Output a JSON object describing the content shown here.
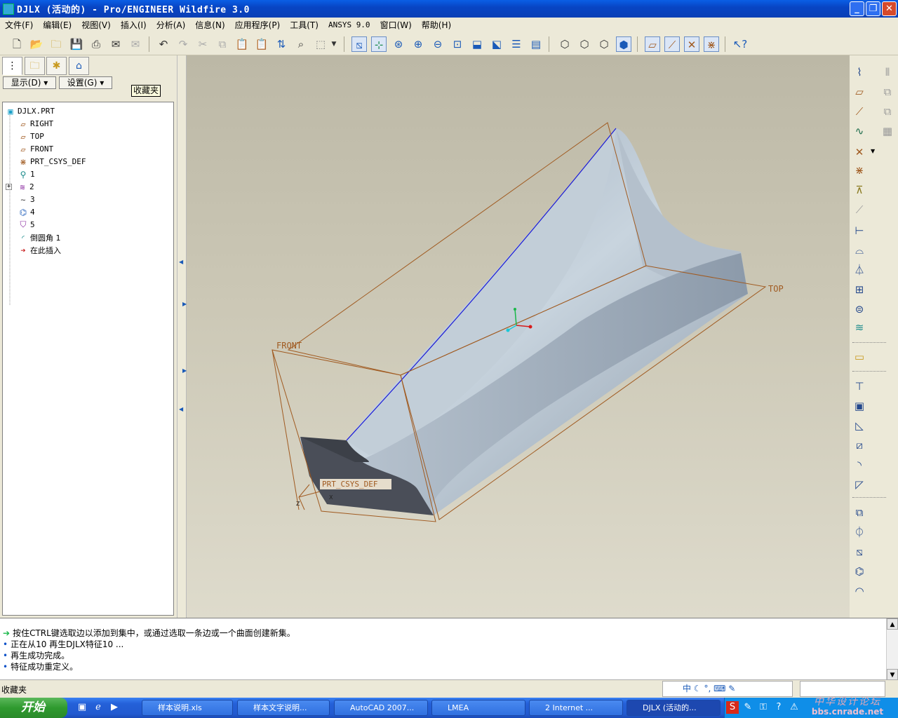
{
  "window": {
    "title": "DJLX (活动的) - Pro/ENGINEER Wildfire 3.0",
    "minimize": "_",
    "restore": "❐",
    "close": "✕"
  },
  "menu": [
    "文件(F)",
    "编辑(E)",
    "视图(V)",
    "插入(I)",
    "分析(A)",
    "信息(N)",
    "应用程序(P)",
    "工具(T)",
    "ANSYS 9.0",
    "窗口(W)",
    "帮助(H)"
  ],
  "left_panel": {
    "display_button": "显示(D)",
    "settings_button": "设置(G)",
    "tooltip": "收藏夹",
    "tree": [
      {
        "label": "DJLX.PRT",
        "icon": "part-icon"
      },
      {
        "label": "RIGHT",
        "icon": "datum-plane-icon"
      },
      {
        "label": "TOP",
        "icon": "datum-plane-icon"
      },
      {
        "label": "FRONT",
        "icon": "datum-plane-icon"
      },
      {
        "label": "PRT_CSYS_DEF",
        "icon": "csys-icon"
      },
      {
        "label": "1",
        "icon": "feature-icon"
      },
      {
        "label": "2",
        "icon": "sketch-group-icon"
      },
      {
        "label": "3",
        "icon": "curve-icon"
      },
      {
        "label": "4",
        "icon": "surface-icon"
      },
      {
        "label": "5",
        "icon": "boundary-icon"
      },
      {
        "label": "倒圆角 1",
        "icon": "round-icon"
      },
      {
        "label": "在此插入",
        "icon": "insert-arrow-icon"
      }
    ]
  },
  "viewport": {
    "labels": {
      "front": "FRONT",
      "top": "TOP",
      "csys": "PRT_CSYS_DEF",
      "x_axis": "X",
      "z_axis": "Z"
    }
  },
  "messages": [
    "按住CTRL键选取边以添加到集中，或通过选取一条边或一个曲面创建新集。",
    "正在从10 再生DJLX特征10 ...",
    "再生成功完成。",
    "特征成功重定义。"
  ],
  "status": {
    "text": "收藏夹"
  },
  "taskbar": {
    "start": "开始",
    "tasks": [
      "样本说明.xls",
      "样本文字说明...",
      "AutoCAD 2007...",
      "LMEA",
      "2 Internet ...",
      "DJLX (活动的..."
    ],
    "watermark_top": "中华设计论坛",
    "watermark_bottom": "bbs.cnrade.net"
  },
  "colors": {
    "accent": "#0a3fb6",
    "datum": "#a05a20",
    "model": "#aab8c6",
    "edge_highlight": "#1a1ad8"
  }
}
